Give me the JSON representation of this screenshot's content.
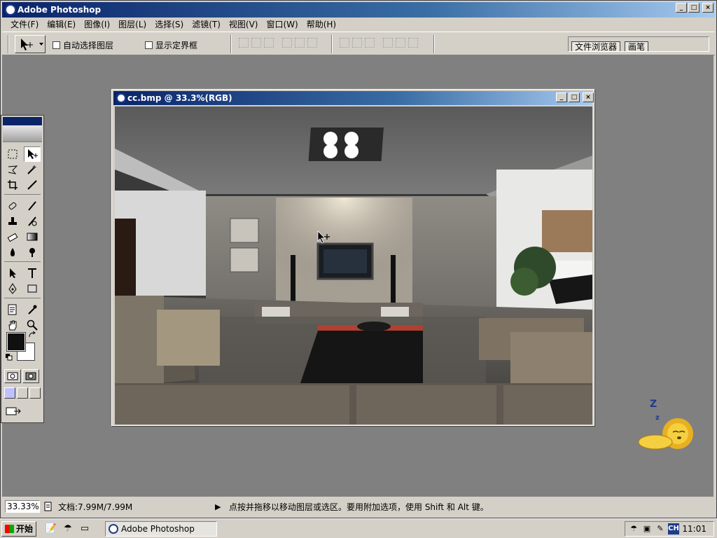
{
  "window": {
    "title": "Adobe Photoshop",
    "minimize": "_",
    "maximize": "□",
    "close": "×"
  },
  "menu": {
    "items": [
      "文件(F)",
      "编辑(E)",
      "图像(I)",
      "图层(L)",
      "选择(S)",
      "滤镜(T)",
      "视图(V)",
      "窗口(W)",
      "帮助(H)"
    ]
  },
  "options_bar": {
    "auto_select_layer": "自动选择图层",
    "show_bounding_box": "显示定界框",
    "palette_tabs": [
      "文件浏览器",
      "画笔"
    ]
  },
  "document": {
    "title": "cc.bmp @ 33.3%(RGB)",
    "minimize": "_",
    "maximize": "□",
    "close": "×"
  },
  "status_bar": {
    "zoom": "33.33%",
    "doc_size": "文档:7.99M/7.99M",
    "message": "点按并拖移以移动图层或选区。要用附加选项，使用 Shift 和 Alt 键。"
  },
  "taskbar": {
    "start_label": "开始",
    "task_label": "Adobe Photoshop",
    "ime_label": "CH",
    "clock": "11:01"
  },
  "assistant": {
    "snore": "Z"
  },
  "colors": {
    "title_active": "#0a246a",
    "workspace": "#808080",
    "chrome": "#d4d0c8",
    "foreground_swatch": "#101010",
    "background_swatch": "#ffffff"
  }
}
